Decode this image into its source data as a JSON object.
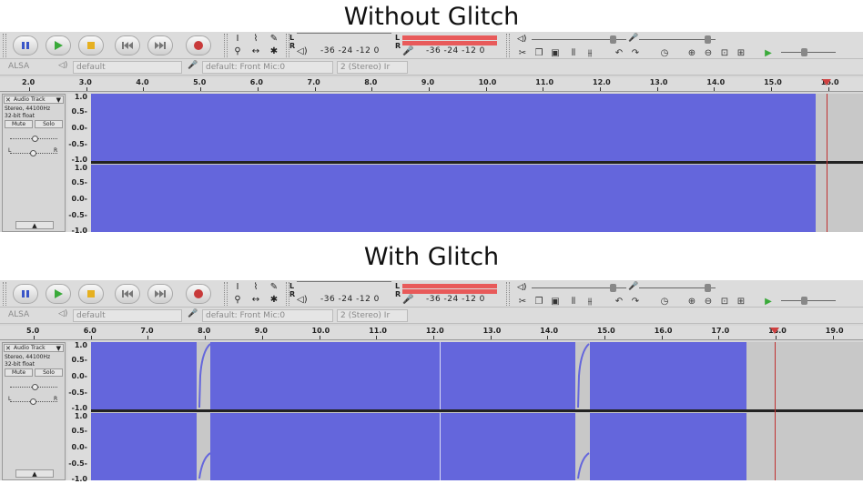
{
  "panels": [
    {
      "heading": "Without Glitch",
      "device": {
        "host": "ALSA",
        "playback": "default",
        "recording": "default: Front Mic:0",
        "channels": "2 (Stereo) Ir"
      },
      "meter": {
        "lr_top": "L\nR",
        "ticks": "-36  -24  -12  0",
        "ticks2": "-36  -24  -12  0"
      },
      "ruler_ticks": [
        "2.0",
        "3.0",
        "4.0",
        "5.0",
        "6.0",
        "7.0",
        "8.0",
        "9.0",
        "10.0",
        "11.0",
        "12.0",
        "13.0",
        "14.0",
        "15.0",
        "16.0"
      ],
      "track": {
        "name": "Audio Track",
        "format_line1": "Stereo, 44100Hz",
        "format_line2": "32-bit float",
        "mute": "Mute",
        "solo": "Solo",
        "pan_left": "L",
        "pan_right": "R"
      },
      "vscale_top": [
        "1.0",
        "0.5-",
        "0.0-",
        "-0.5-",
        "-1.0"
      ],
      "vscale_bottom": [
        "1.0",
        "0.5-",
        "0.0-",
        "-0.5-",
        "-1.0"
      ]
    },
    {
      "heading": "With Glitch",
      "device": {
        "host": "ALSA",
        "playback": "default",
        "recording": "default: Front Mic:0",
        "channels": "2 (Stereo) Ir"
      },
      "meter": {
        "lr_top": "L\nR",
        "ticks": "-36  -24  -12  0",
        "ticks2": "-36  -24  -12  0"
      },
      "ruler_ticks": [
        "5.0",
        "6.0",
        "7.0",
        "8.0",
        "9.0",
        "10.0",
        "11.0",
        "12.0",
        "13.0",
        "14.0",
        "15.0",
        "16.0",
        "17.0",
        "18.0",
        "19.0"
      ],
      "track": {
        "name": "Audio Track",
        "format_line1": "Stereo, 44100Hz",
        "format_line2": "32-bit float",
        "mute": "Mute",
        "solo": "Solo",
        "pan_left": "L",
        "pan_right": "R"
      },
      "vscale_top": [
        "1.0",
        "0.5-",
        "0.0-",
        "-0.5-",
        "-1.0"
      ],
      "vscale_bottom": [
        "1.0",
        "0.5-",
        "0.0-",
        "-0.5-",
        "-1.0"
      ]
    }
  ],
  "colors": {
    "waveform": "#6466dc",
    "background": "#c8c8c8",
    "meter": "#e85a5a",
    "cursor": "#c03030"
  },
  "icons": [
    "pause-icon",
    "play-icon",
    "stop-icon",
    "skip-start-icon",
    "skip-end-icon",
    "record-icon",
    "selection-tool-icon",
    "envelope-tool-icon",
    "draw-tool-icon",
    "zoom-tool-icon",
    "timeshift-tool-icon",
    "multi-tool-icon",
    "speaker-icon",
    "microphone-icon"
  ]
}
